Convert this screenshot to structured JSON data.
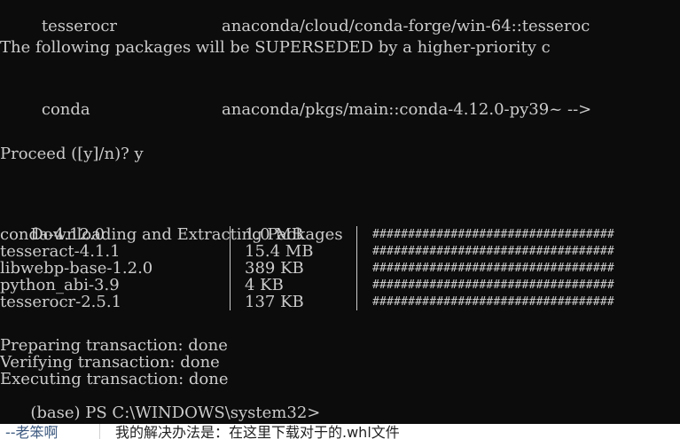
{
  "terminal": {
    "line_first_name": "tesserocr",
    "line_first_path": "anaconda/cloud/conda-forge/win-64::tesseroc",
    "superseded_line": "The following packages will be SUPERSEDED by a higher-priority c",
    "conda_line_name": "conda",
    "conda_line_path": "anaconda/pkgs/main::conda-4.12.0-py39~ -->",
    "proceed_prompt": "Proceed ([y]/n)? y",
    "downloading_header": "Downloading and Extracting Packages",
    "packages": [
      {
        "name": "conda-4.12.0",
        "size": "1.0 MB",
        "bar": "##################################"
      },
      {
        "name": "tesseract-4.1.1",
        "size": "15.4 MB",
        "bar": "##################################"
      },
      {
        "name": "libwebp-base-1.2.0",
        "size": "389 KB",
        "bar": "##################################"
      },
      {
        "name": "python_abi-3.9",
        "size": "4 KB",
        "bar": "##################################"
      },
      {
        "name": "tesserocr-2.5.1",
        "size": "137 KB",
        "bar": "##################################"
      }
    ],
    "status_lines": [
      "Preparing transaction: done",
      "Verifying transaction: done",
      "Executing transaction: done"
    ],
    "prompt": "(base) PS C:\\WINDOWS\\system32>"
  },
  "comment": {
    "user": "--老笨啊",
    "text": "我的解决办法是：在这里下载对于的.whl文件"
  },
  "colors": {
    "terminal_bg": "#0c0c0c",
    "terminal_fg": "#cccccc",
    "comment_bg": "#ffffff",
    "comment_user": "#3d5a80"
  }
}
